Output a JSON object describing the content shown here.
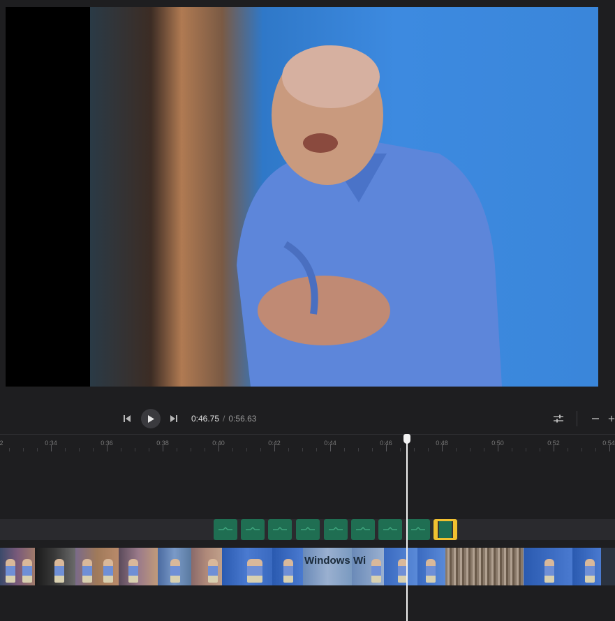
{
  "player": {
    "current_time": "0:46.75",
    "separator": "/",
    "duration": "0:56.63",
    "playhead_time": "0:46.75"
  },
  "controls": {
    "skip_back_icon": "skip-back-icon",
    "play_icon": "play-icon",
    "skip_forward_icon": "skip-forward-icon",
    "adjust_icon": "sliders-icon",
    "zoom_out_icon": "minus-icon"
  },
  "ruler": {
    "labels": [
      "2",
      "0:34",
      "0:36",
      "0:38",
      "0:40",
      "0:42",
      "0:44",
      "0:46",
      "0:48",
      "0:50",
      "0:52",
      "0:54"
    ]
  },
  "audio_track": {
    "clip_count": 9,
    "selected_clip_index": 8
  },
  "video_track": {
    "thumbnail_text": "Windows",
    "thumbnail_text_2": "Wi"
  },
  "colors": {
    "background": "#1e1e20",
    "audio_clip": "#1f6e52",
    "selected_clip": "#f0c030",
    "playhead": "#f2f2f2"
  }
}
